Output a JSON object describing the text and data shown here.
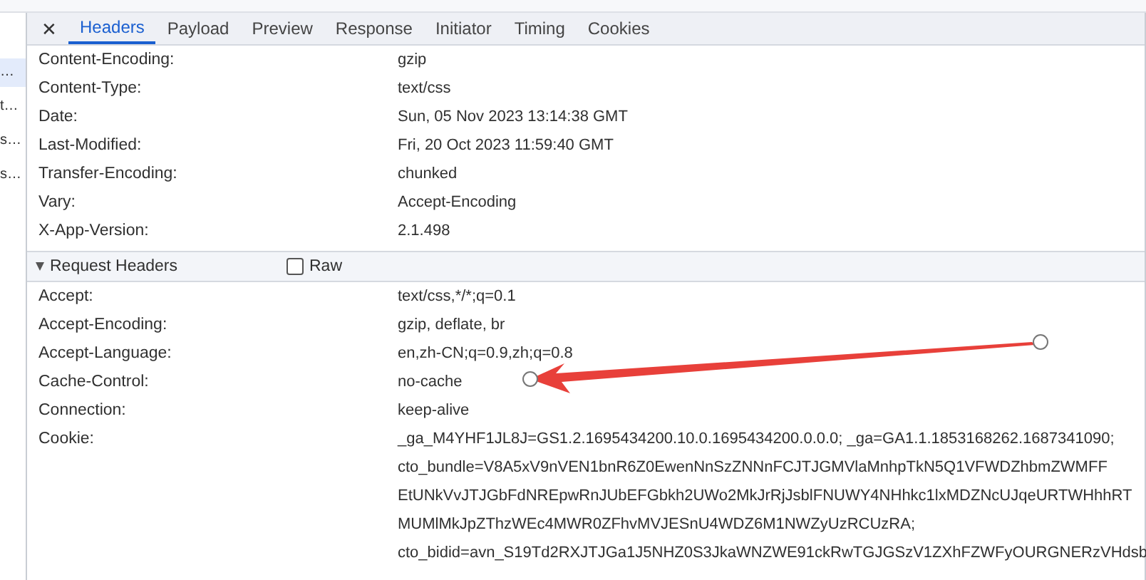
{
  "sidebar": {
    "items": [
      {
        "label": "…",
        "selected": true
      },
      {
        "label": "t…",
        "selected": false
      },
      {
        "label": "s…",
        "selected": false
      },
      {
        "label": "s…",
        "selected": false
      }
    ]
  },
  "tabs": [
    {
      "label": "Headers",
      "selected": true
    },
    {
      "label": "Payload",
      "selected": false
    },
    {
      "label": "Preview",
      "selected": false
    },
    {
      "label": "Response",
      "selected": false
    },
    {
      "label": "Initiator",
      "selected": false
    },
    {
      "label": "Timing",
      "selected": false
    },
    {
      "label": "Cookies",
      "selected": false
    }
  ],
  "close_label": "✕",
  "response_headers": [
    {
      "name": "Content-Encoding:",
      "value": "gzip"
    },
    {
      "name": "Content-Type:",
      "value": "text/css"
    },
    {
      "name": "Date:",
      "value": "Sun, 05 Nov 2023 13:14:38 GMT"
    },
    {
      "name": "Last-Modified:",
      "value": "Fri, 20 Oct 2023 11:59:40 GMT"
    },
    {
      "name": "Transfer-Encoding:",
      "value": "chunked"
    },
    {
      "name": "Vary:",
      "value": "Accept-Encoding"
    },
    {
      "name": "X-App-Version:",
      "value": "2.1.498"
    }
  ],
  "request_section": {
    "title": "Request Headers",
    "expanded": true,
    "raw": {
      "label": "Raw",
      "checked": false
    }
  },
  "request_headers": [
    {
      "name": "Accept:",
      "value": [
        "text/css,*/*;q=0.1"
      ]
    },
    {
      "name": "Accept-Encoding:",
      "value": [
        "gzip, deflate, br"
      ]
    },
    {
      "name": "Accept-Language:",
      "value": [
        "en,zh-CN;q=0.9,zh;q=0.8"
      ]
    },
    {
      "name": "Cache-Control:",
      "value": [
        "no-cache"
      ]
    },
    {
      "name": "Connection:",
      "value": [
        "keep-alive"
      ]
    },
    {
      "name": "Cookie:",
      "value": [
        "_ga_M4YHF1JL8J=GS1.2.1695434200.10.0.1695434200.0.0.0; _ga=GA1.1.1853168262.1687341090;",
        "cto_bundle=V8A5xV9nVEN1bnR6Z0EwenNnSzZNNnFCJTJGMVlaMnhpTkN5Q1VFWDZhbmZWMFF",
        "EtUNkVvJTJGbFdNREpwRnJUbEFGbkh2UWo2MkJrRjJsblFNUWY4NHhkc1lxMDZNcUJqeURTWHhhRT",
        "MUMlMkJpZThzWEc4MWR0ZFhvMVJESnU4WDZ6M1NWZyUzRCUzRA;",
        "cto_bidid=avn_S19Td2RXJTJGa1J5NHZ0S3JkaWNZWE91ckRwTGJGSzV1ZXhFZWFyOURGNERzVHdsb"
      ]
    }
  ]
}
